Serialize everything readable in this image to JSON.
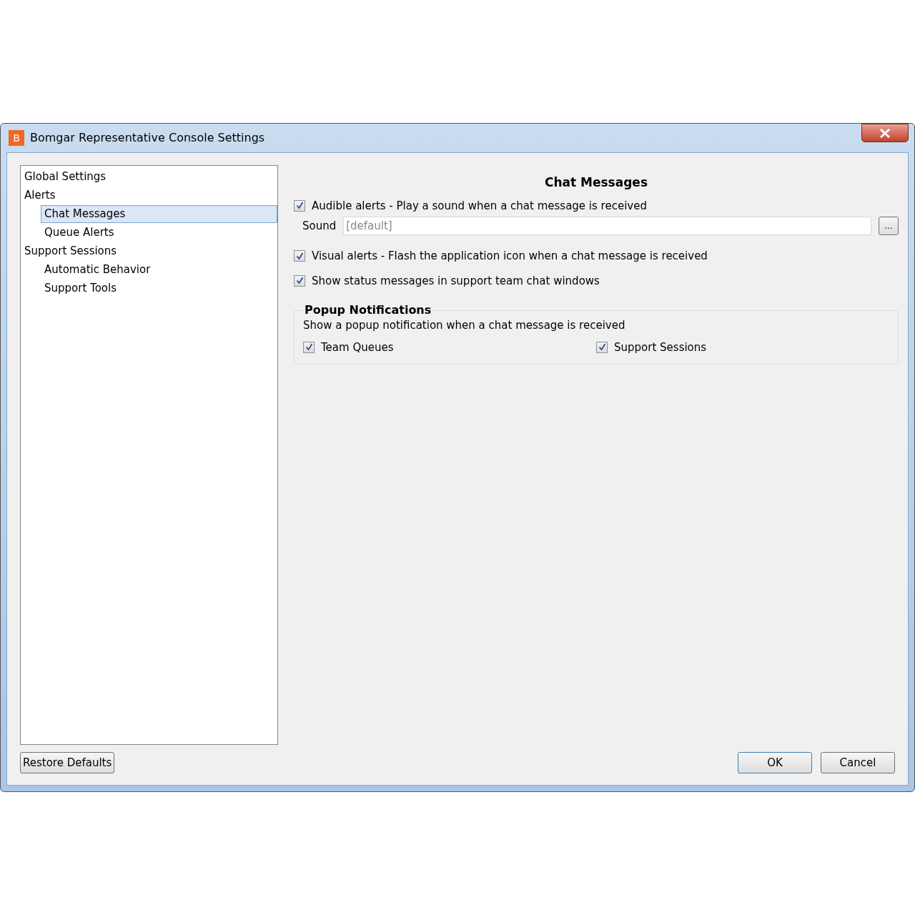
{
  "window": {
    "title": "Bomgar Representative Console Settings",
    "logo": "B"
  },
  "tree": [
    {
      "label": "Global Settings",
      "selected": false
    },
    {
      "label": "Alerts",
      "selected": false,
      "children": [
        {
          "label": "Chat Messages",
          "selected": true
        },
        {
          "label": "Queue Alerts",
          "selected": false
        }
      ]
    },
    {
      "label": "Support Sessions",
      "selected": false,
      "children": [
        {
          "label": "Automatic Behavior",
          "selected": false
        },
        {
          "label": "Support Tools",
          "selected": false
        }
      ]
    }
  ],
  "panel": {
    "title": "Chat Messages",
    "options": [
      {
        "kind": "checkbox",
        "label": "Audible alerts - Play a sound when a chat message is received",
        "checked": true
      },
      {
        "kind": "field",
        "label": "Sound",
        "placeholder": "[default]",
        "button": "..."
      },
      {
        "kind": "checkbox",
        "label": "Visual alerts - Flash the application icon when a chat message is received",
        "checked": true
      },
      {
        "kind": "checkbox",
        "label": "Show status messages in support team chat windows",
        "checked": true
      }
    ]
  },
  "popup": {
    "title": "Popup Notifications",
    "description": "Show a popup notification when a chat message is received",
    "options": [
      {
        "label": "Team Queues",
        "checked": true
      },
      {
        "label": "Support Sessions",
        "checked": true
      }
    ]
  },
  "buttons": {
    "restore": "Restore Defaults",
    "ok": "OK",
    "cancel": "Cancel"
  }
}
